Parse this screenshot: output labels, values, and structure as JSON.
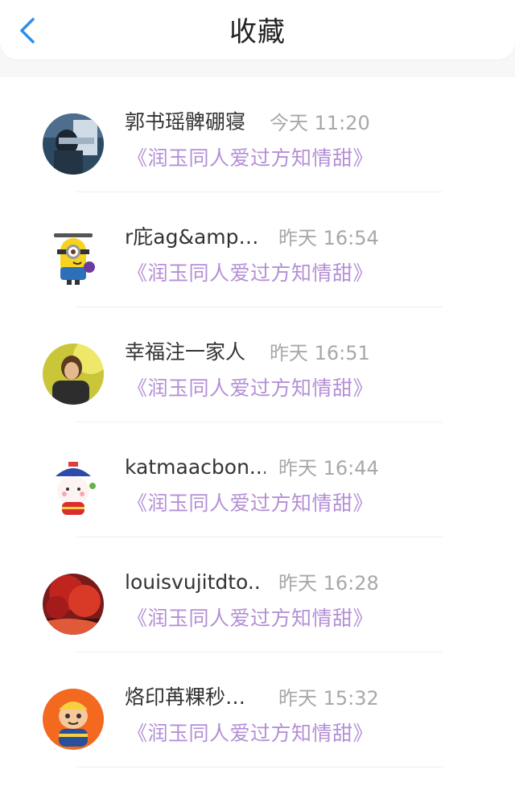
{
  "header": {
    "title": "收藏",
    "back_icon": "chevron-left-icon",
    "accent": "#2f8ee8"
  },
  "favorites": [
    {
      "name": "郭书瑶髀硼寝",
      "time": "今天 11:20",
      "book": "《润玉同人爱过方知情甜》",
      "avatar": "photo-avatar"
    },
    {
      "name": "r庇ag&amp…",
      "time": "昨天 16:54",
      "book": "《润玉同人爱过方知情甜》",
      "avatar": "minion-avatar"
    },
    {
      "name": "幸福注一家人",
      "time": "昨天 16:51",
      "book": "《润玉同人爱过方知情甜》",
      "avatar": "photo-avatar"
    },
    {
      "name": "katmaacbon...",
      "time": "昨天 16:44",
      "book": "《润玉同人爱过方知情甜》",
      "avatar": "cartoon-avatar"
    },
    {
      "name": "louisvujitdto..",
      "time": "昨天 16:28",
      "book": "《润玉同人爱过方知情甜》",
      "avatar": "red-tree-avatar"
    },
    {
      "name": "烙印苒粿秒…",
      "time": "昨天 15:32",
      "book": "《润玉同人爱过方知情甜》",
      "avatar": "cartoon-avatar"
    }
  ],
  "colors": {
    "book_title": "#b48fd6",
    "timestamp": "#a8a8a8",
    "name": "#333333"
  }
}
